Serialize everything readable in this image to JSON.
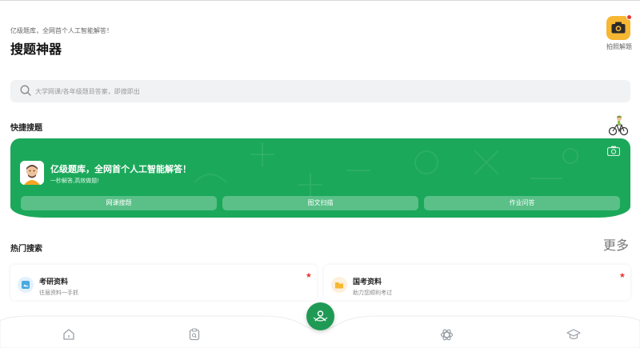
{
  "header": {
    "subtitle": "亿级题库，全网首个人工智能解答！",
    "title": "搜题神器",
    "camera_label": "拍照解题"
  },
  "search": {
    "placeholder": "大学网课/各年级题目答案，即搜即出"
  },
  "quick_search": {
    "title": "快捷搜题",
    "headline": "亿级题库，全网首个人工智能解答！",
    "subline": "一秒解答,高效做题!",
    "buttons": [
      "网课搜题",
      "图文扫描",
      "作业问答"
    ]
  },
  "hot_search": {
    "title": "热门搜索",
    "more_label": "更多",
    "cards": [
      {
        "name": "考研资料",
        "desc": "往届资料一手抓"
      },
      {
        "name": "国考资料",
        "desc": "助力您顺利考过"
      }
    ]
  },
  "colors": {
    "brand_green": "#1ba85a",
    "accent_orange": "#f6b733",
    "star_red": "#e53935"
  },
  "icons": {
    "tab1": "home-icon",
    "tab2": "clipboard-search-icon",
    "tab3": "ai-knot-icon",
    "tab4": "graduation-cap-icon",
    "fab": "scan-person-icon"
  }
}
